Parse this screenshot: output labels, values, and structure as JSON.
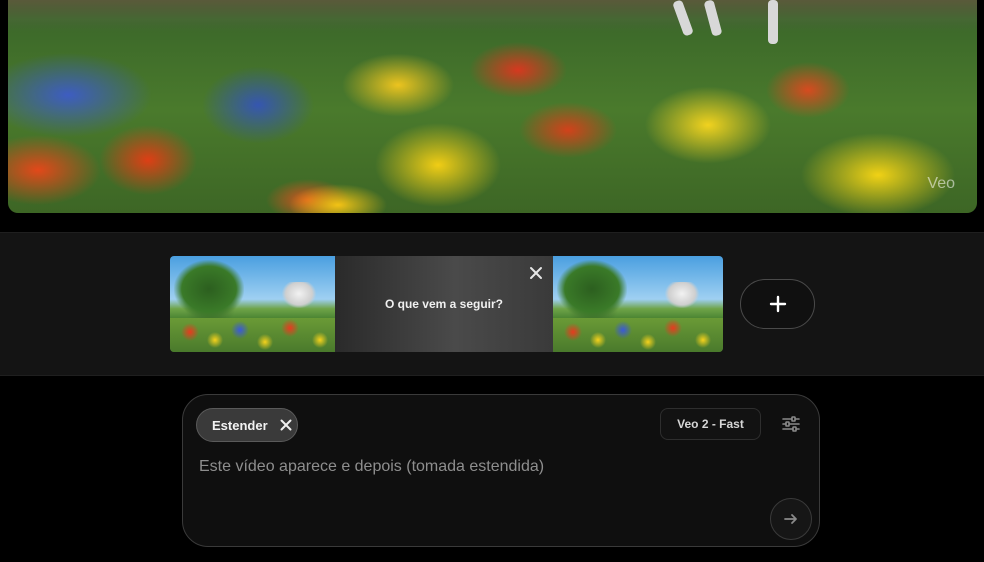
{
  "video": {
    "watermark": "Veo"
  },
  "timeline": {
    "placeholder_text": "O que vem a seguir?",
    "icons": {
      "close": "close-icon",
      "add": "plus-icon"
    }
  },
  "prompt": {
    "chip_label": "Estender",
    "model_label": "Veo 2 - Fast",
    "placeholder": "Este vídeo aparece e depois (tomada estendida)",
    "value": "",
    "icons": {
      "chip_close": "close-icon",
      "settings": "sliders-icon",
      "send": "arrow-right-icon"
    }
  }
}
